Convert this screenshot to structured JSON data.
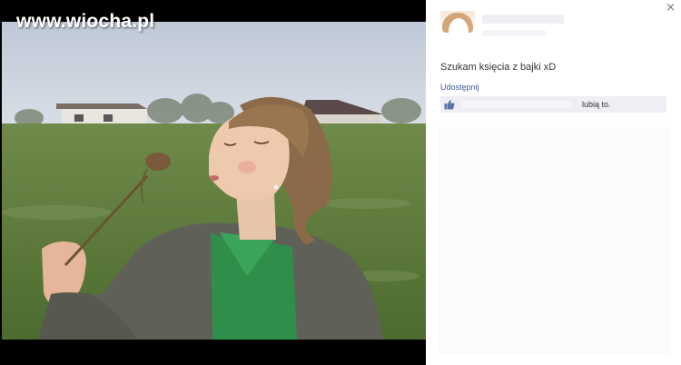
{
  "watermark": "www.wiocha.pl",
  "photo": {
    "alt": ""
  },
  "post": {
    "status": "Szukam księcia z bajki xD",
    "share_label": "Udostępnij",
    "like_text": "lubią to."
  },
  "close_label": "×",
  "colors": {
    "link": "#3b5998",
    "like_bar": "#edeff4"
  }
}
